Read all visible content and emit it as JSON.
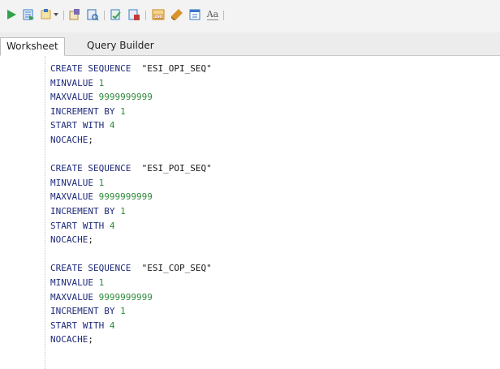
{
  "toolbar": {
    "buttons": [
      {
        "name": "run-statement-icon",
        "color": "#2fa34a"
      },
      {
        "name": "run-script-icon",
        "color": "#3a78c8"
      },
      {
        "name": "commit-icon",
        "color": "#c9a13b"
      },
      {
        "name": "rollback-icon",
        "color": "#7a6bb5"
      },
      {
        "name": "explain-plan-icon",
        "color": "#2f6fb0"
      },
      {
        "name": "autotrace-icon",
        "color": "#3aa35a"
      },
      {
        "name": "sql-tuning-icon",
        "color": "#c23b3b"
      },
      {
        "name": "sql-history-icon",
        "color": "#c78a1e"
      },
      {
        "name": "clear-icon",
        "color": "#d9932a"
      },
      {
        "name": "unshared-sql-icon",
        "color": "#3a78c8"
      },
      {
        "name": "to-upper-case-icon",
        "color": "#5a5a5a"
      }
    ],
    "upper_case_glyph": "Aa"
  },
  "tabs": [
    {
      "label": "Worksheet",
      "active": true
    },
    {
      "label": "Query Builder",
      "active": false
    }
  ],
  "colors": {
    "keyword": "#1e2a7a",
    "number": "#2e8b3a",
    "string": "#1a1a1a"
  },
  "editor": {
    "lines": [
      [
        {
          "t": "CREATE SEQUENCE",
          "c": "kw"
        },
        {
          "t": "  ",
          "c": "pn"
        },
        {
          "t": "\"ESI_OPI_SEQ\"",
          "c": "str"
        }
      ],
      [
        {
          "t": "MINVALUE",
          "c": "kw"
        },
        {
          "t": " ",
          "c": "pn"
        },
        {
          "t": "1",
          "c": "num"
        }
      ],
      [
        {
          "t": "MAXVALUE",
          "c": "kw"
        },
        {
          "t": " ",
          "c": "pn"
        },
        {
          "t": "9999999999",
          "c": "num"
        }
      ],
      [
        {
          "t": "INCREMENT BY",
          "c": "kw"
        },
        {
          "t": " ",
          "c": "pn"
        },
        {
          "t": "1",
          "c": "num"
        }
      ],
      [
        {
          "t": "START WITH",
          "c": "kw"
        },
        {
          "t": " ",
          "c": "pn"
        },
        {
          "t": "4",
          "c": "num"
        }
      ],
      [
        {
          "t": "NOCACHE",
          "c": "kw"
        },
        {
          "t": ";",
          "c": "pn"
        }
      ],
      [],
      [
        {
          "t": "CREATE SEQUENCE",
          "c": "kw"
        },
        {
          "t": "  ",
          "c": "pn"
        },
        {
          "t": "\"ESI_POI_SEQ\"",
          "c": "str"
        }
      ],
      [
        {
          "t": "MINVALUE",
          "c": "kw"
        },
        {
          "t": " ",
          "c": "pn"
        },
        {
          "t": "1",
          "c": "num"
        }
      ],
      [
        {
          "t": "MAXVALUE",
          "c": "kw"
        },
        {
          "t": " ",
          "c": "pn"
        },
        {
          "t": "9999999999",
          "c": "num"
        }
      ],
      [
        {
          "t": "INCREMENT BY",
          "c": "kw"
        },
        {
          "t": " ",
          "c": "pn"
        },
        {
          "t": "1",
          "c": "num"
        }
      ],
      [
        {
          "t": "START WITH",
          "c": "kw"
        },
        {
          "t": " ",
          "c": "pn"
        },
        {
          "t": "4",
          "c": "num"
        }
      ],
      [
        {
          "t": "NOCACHE",
          "c": "kw"
        },
        {
          "t": ";",
          "c": "pn"
        }
      ],
      [],
      [
        {
          "t": "CREATE SEQUENCE",
          "c": "kw"
        },
        {
          "t": "  ",
          "c": "pn"
        },
        {
          "t": "\"ESI_COP_SEQ\"",
          "c": "str"
        }
      ],
      [
        {
          "t": "MINVALUE",
          "c": "kw"
        },
        {
          "t": " ",
          "c": "pn"
        },
        {
          "t": "1",
          "c": "num"
        }
      ],
      [
        {
          "t": "MAXVALUE",
          "c": "kw"
        },
        {
          "t": " ",
          "c": "pn"
        },
        {
          "t": "9999999999",
          "c": "num"
        }
      ],
      [
        {
          "t": "INCREMENT BY",
          "c": "kw"
        },
        {
          "t": " ",
          "c": "pn"
        },
        {
          "t": "1",
          "c": "num"
        }
      ],
      [
        {
          "t": "START WITH",
          "c": "kw"
        },
        {
          "t": " ",
          "c": "pn"
        },
        {
          "t": "4",
          "c": "num"
        }
      ],
      [
        {
          "t": "NOCACHE",
          "c": "kw"
        },
        {
          "t": ";",
          "c": "pn"
        }
      ]
    ]
  }
}
